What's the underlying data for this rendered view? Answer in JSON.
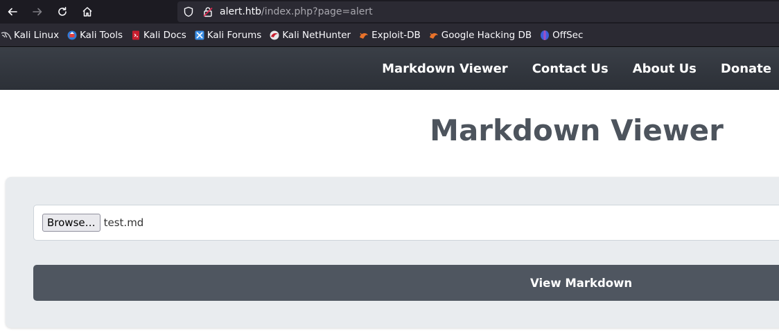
{
  "browser": {
    "url_host": "alert.htb",
    "url_path": "/index.php?page=alert",
    "bookmarks": [
      {
        "label": "Kali Linux",
        "icon": "kali-dragon-icon"
      },
      {
        "label": "Kali Tools",
        "icon": "kali-tools-icon"
      },
      {
        "label": "Kali Docs",
        "icon": "kali-docs-icon"
      },
      {
        "label": "Kali Forums",
        "icon": "kali-forums-icon"
      },
      {
        "label": "Kali NetHunter",
        "icon": "kali-nethunter-icon"
      },
      {
        "label": "Exploit-DB",
        "icon": "exploit-db-icon"
      },
      {
        "label": "Google Hacking DB",
        "icon": "ghdb-icon"
      },
      {
        "label": "OffSec",
        "icon": "offsec-icon"
      }
    ]
  },
  "site_nav": {
    "items": [
      "Markdown Viewer",
      "Contact Us",
      "About Us",
      "Donate"
    ]
  },
  "main": {
    "title": "Markdown Viewer",
    "file_input": {
      "browse_label": "Browse…",
      "selected_file": "test.md"
    },
    "submit_label": "View Markdown"
  },
  "colors": {
    "nav_bg": "#343a40",
    "title": "#4d545d",
    "panel_bg": "#e9ecef",
    "button_bg": "#4f5660"
  }
}
